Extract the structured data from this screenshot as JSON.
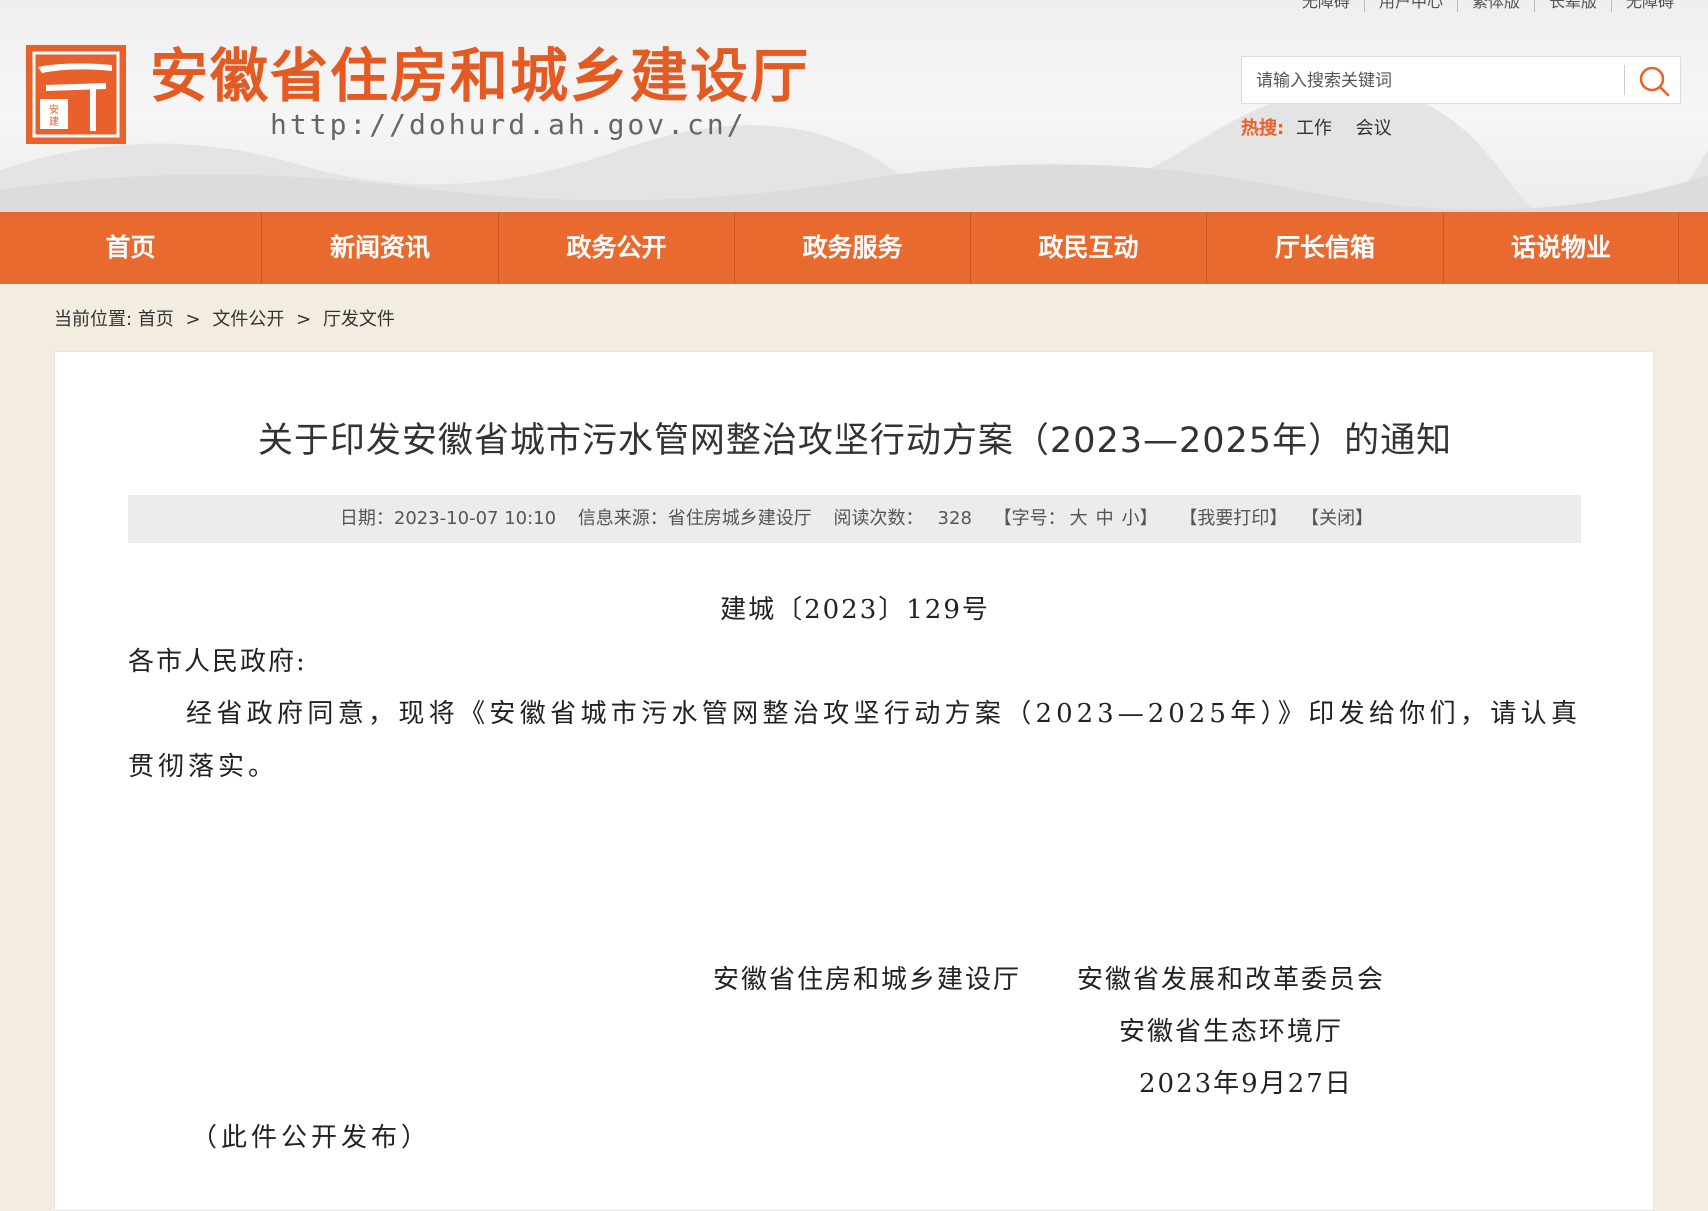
{
  "top_links": [
    "无障碍",
    "用户中心",
    "繁体版",
    "长辈版",
    "无障碍"
  ],
  "site": {
    "title": "安徽省住房和城乡建设厅",
    "url": "http://dohurd.ah.gov.cn/",
    "logo_seal_text": "安徽建设"
  },
  "search": {
    "placeholder": "请输入搜索关键词",
    "hot_label": "热搜:",
    "hot_keywords": [
      "工作",
      "会议"
    ]
  },
  "nav": [
    {
      "label": "首页"
    },
    {
      "label": "新闻资讯"
    },
    {
      "label": "政务公开"
    },
    {
      "label": "政务服务"
    },
    {
      "label": "政民互动"
    },
    {
      "label": "厅长信箱"
    },
    {
      "label": "话说物业"
    }
  ],
  "breadcrumb": {
    "prefix": "当前位置:",
    "items": [
      "首页",
      "文件公开",
      "厅发文件"
    ],
    "separator": ">"
  },
  "article": {
    "title": "关于印发安徽省城市污水管网整治攻坚行动方案（2023—2025年）的通知",
    "meta": {
      "date": "日期：2023-10-07 10:10",
      "source": "信息来源：省住房城乡建设厅",
      "views_label": "阅读次数：",
      "views": "328",
      "font_size_prefix": "【字号：",
      "font_large": "大",
      "font_medium": "中",
      "font_small": "小】",
      "print": "【我要打印】",
      "close": "【关闭】"
    },
    "doc_number": "建城〔2023〕129号",
    "salutation": "各市人民政府:",
    "paragraph": "经省政府同意，现将《安徽省城市污水管网整治攻坚行动方案（2023—2025年）》印发给你们，请认真贯彻落实。",
    "signatories": [
      "安徽省住房和城乡建设厅",
      "安徽省发展和改革委员会",
      "安徽省生态环境厅"
    ],
    "sign_date": "2023年9月27日",
    "publish_note": "（此件公开发布）"
  },
  "colors": {
    "brand_orange": "#e96a2f",
    "title_orange": "#e35a23",
    "page_bg": "#f2ede0"
  }
}
